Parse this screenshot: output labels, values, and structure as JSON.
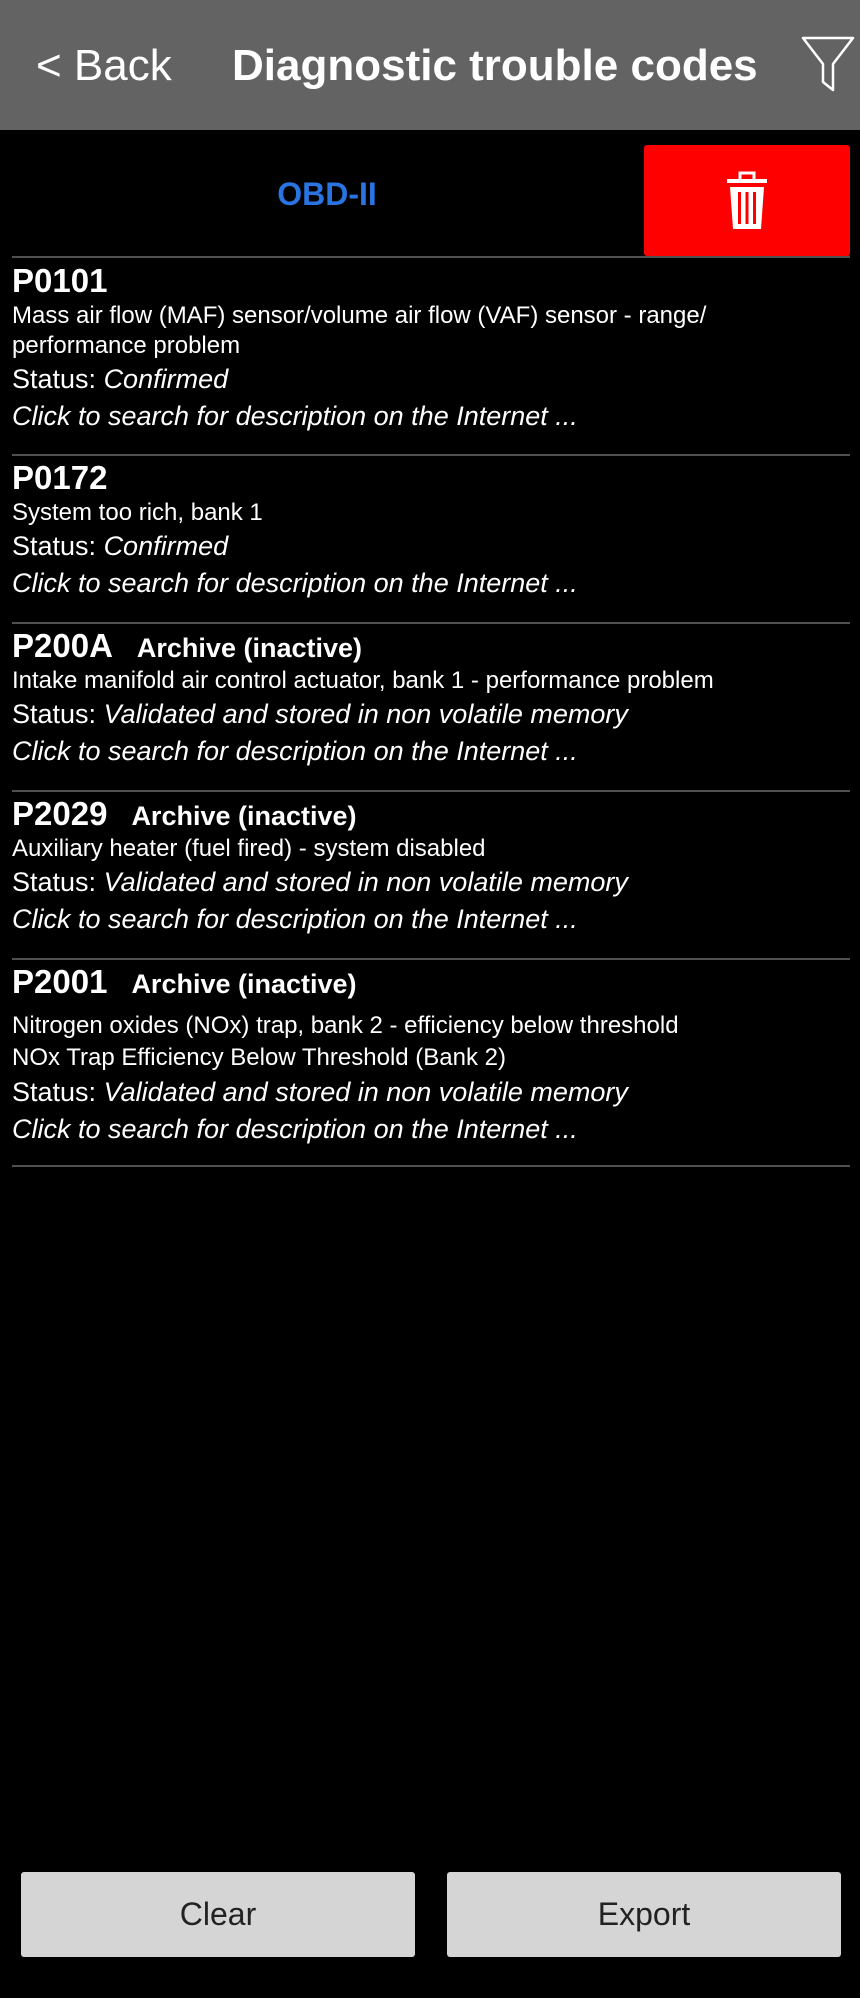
{
  "header": {
    "back_label": "< Back",
    "title": "Diagnostic trouble codes",
    "filter_icon": "filter-icon"
  },
  "tabs": {
    "obd_label": "OBD-II",
    "trash_icon": "trash-icon"
  },
  "dtcs": [
    {
      "code": "P0101",
      "archive": "",
      "desc1": "Mass air flow (MAF) sensor/volume air flow (VAF) sensor - range/",
      "desc2": "performance problem",
      "status_prefix": "Status:",
      "status": "Confirmed",
      "search": "Click to search for description on the Internet ..."
    },
    {
      "code": "P0172",
      "archive": "",
      "desc1": "System too rich, bank 1",
      "desc2": "",
      "status_prefix": "Status:",
      "status": "Confirmed",
      "search": "Click to search for description on the Internet ..."
    },
    {
      "code": "P200A",
      "archive": "Archive (inactive)",
      "desc1": "Intake manifold air control actuator, bank 1 - performance problem",
      "desc2": "",
      "status_prefix": "Status:",
      "status": "Validated and stored in non volatile memory",
      "search": "Click to search for description on the Internet ..."
    },
    {
      "code": "P2029",
      "archive": "Archive (inactive)",
      "desc1": "Auxiliary heater (fuel fired) - system disabled",
      "desc2": "",
      "status_prefix": "Status:",
      "status": "Validated and stored in non volatile memory",
      "search": "Click to search for description on the Internet ..."
    },
    {
      "code": "P2001",
      "archive": "Archive (inactive)",
      "desc1": "Nitrogen oxides (NOx) trap, bank 2 - efficiency below threshold",
      "desc2": "NOx Trap Efficiency Below Threshold (Bank 2)",
      "status_prefix": "Status:",
      "status": "Validated and stored in non volatile memory",
      "search": "Click to search for description on the Internet ..."
    }
  ],
  "footer": {
    "clear_label": "Clear",
    "export_label": "Export"
  },
  "colors": {
    "header_bg": "#636363",
    "accent_blue": "#2a74e2",
    "delete_red": "#ff0000",
    "button_gray": "#d5d5d5"
  }
}
